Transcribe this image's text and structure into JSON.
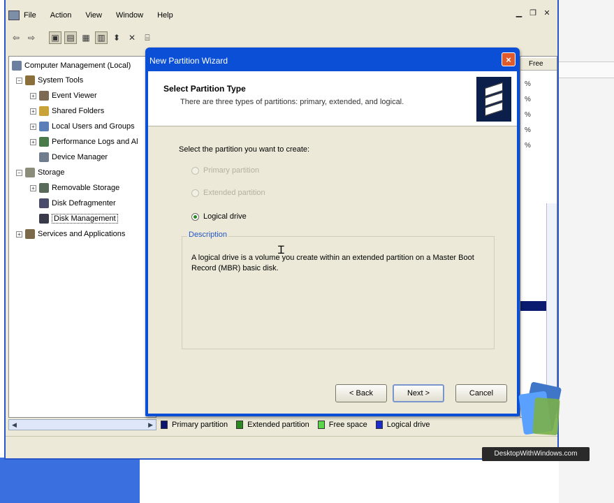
{
  "menu": {
    "items": [
      "File",
      "Action",
      "View",
      "Window",
      "Help"
    ]
  },
  "tree": {
    "root": "Computer Management (Local)",
    "system_tools": "System Tools",
    "event_viewer": "Event Viewer",
    "shared_folders": "Shared Folders",
    "local_users": "Local Users and Groups",
    "perf_logs": "Performance Logs and Al",
    "device_manager": "Device Manager",
    "storage": "Storage",
    "removable_storage": "Removable Storage",
    "disk_defragmenter": "Disk Defragmenter",
    "disk_management": "Disk Management",
    "services": "Services and Applications"
  },
  "right_pane": {
    "header": "Free",
    "percents": [
      "% ",
      "% ",
      "% ",
      "% ",
      "% "
    ]
  },
  "legend": {
    "items": [
      {
        "label": "Primary partition",
        "color": "#0a1570"
      },
      {
        "label": "Extended partition",
        "color": "#2a8a20"
      },
      {
        "label": "Free space",
        "color": "#5bd64a"
      },
      {
        "label": "Logical drive",
        "color": "#1a2acc"
      }
    ]
  },
  "wizard": {
    "title": "New Partition Wizard",
    "close": "×",
    "header_title": "Select Partition Type",
    "header_subtitle": "There are three types of partitions: primary, extended, and logical.",
    "prompt": "Select the partition you want to create:",
    "options": [
      {
        "label": "Primary partition",
        "enabled": false,
        "selected": false
      },
      {
        "label": "Extended partition",
        "enabled": false,
        "selected": false
      },
      {
        "label": "Logical drive",
        "enabled": true,
        "selected": true
      }
    ],
    "description_label": "Description",
    "description_text": "A logical drive is a volume you create within an extended partition on a Master Boot Record (MBR) basic disk.",
    "buttons": {
      "back": "< Back",
      "next": "Next >",
      "cancel": "Cancel"
    }
  },
  "watermark": {
    "text": "DesktopWithWindows.com"
  }
}
